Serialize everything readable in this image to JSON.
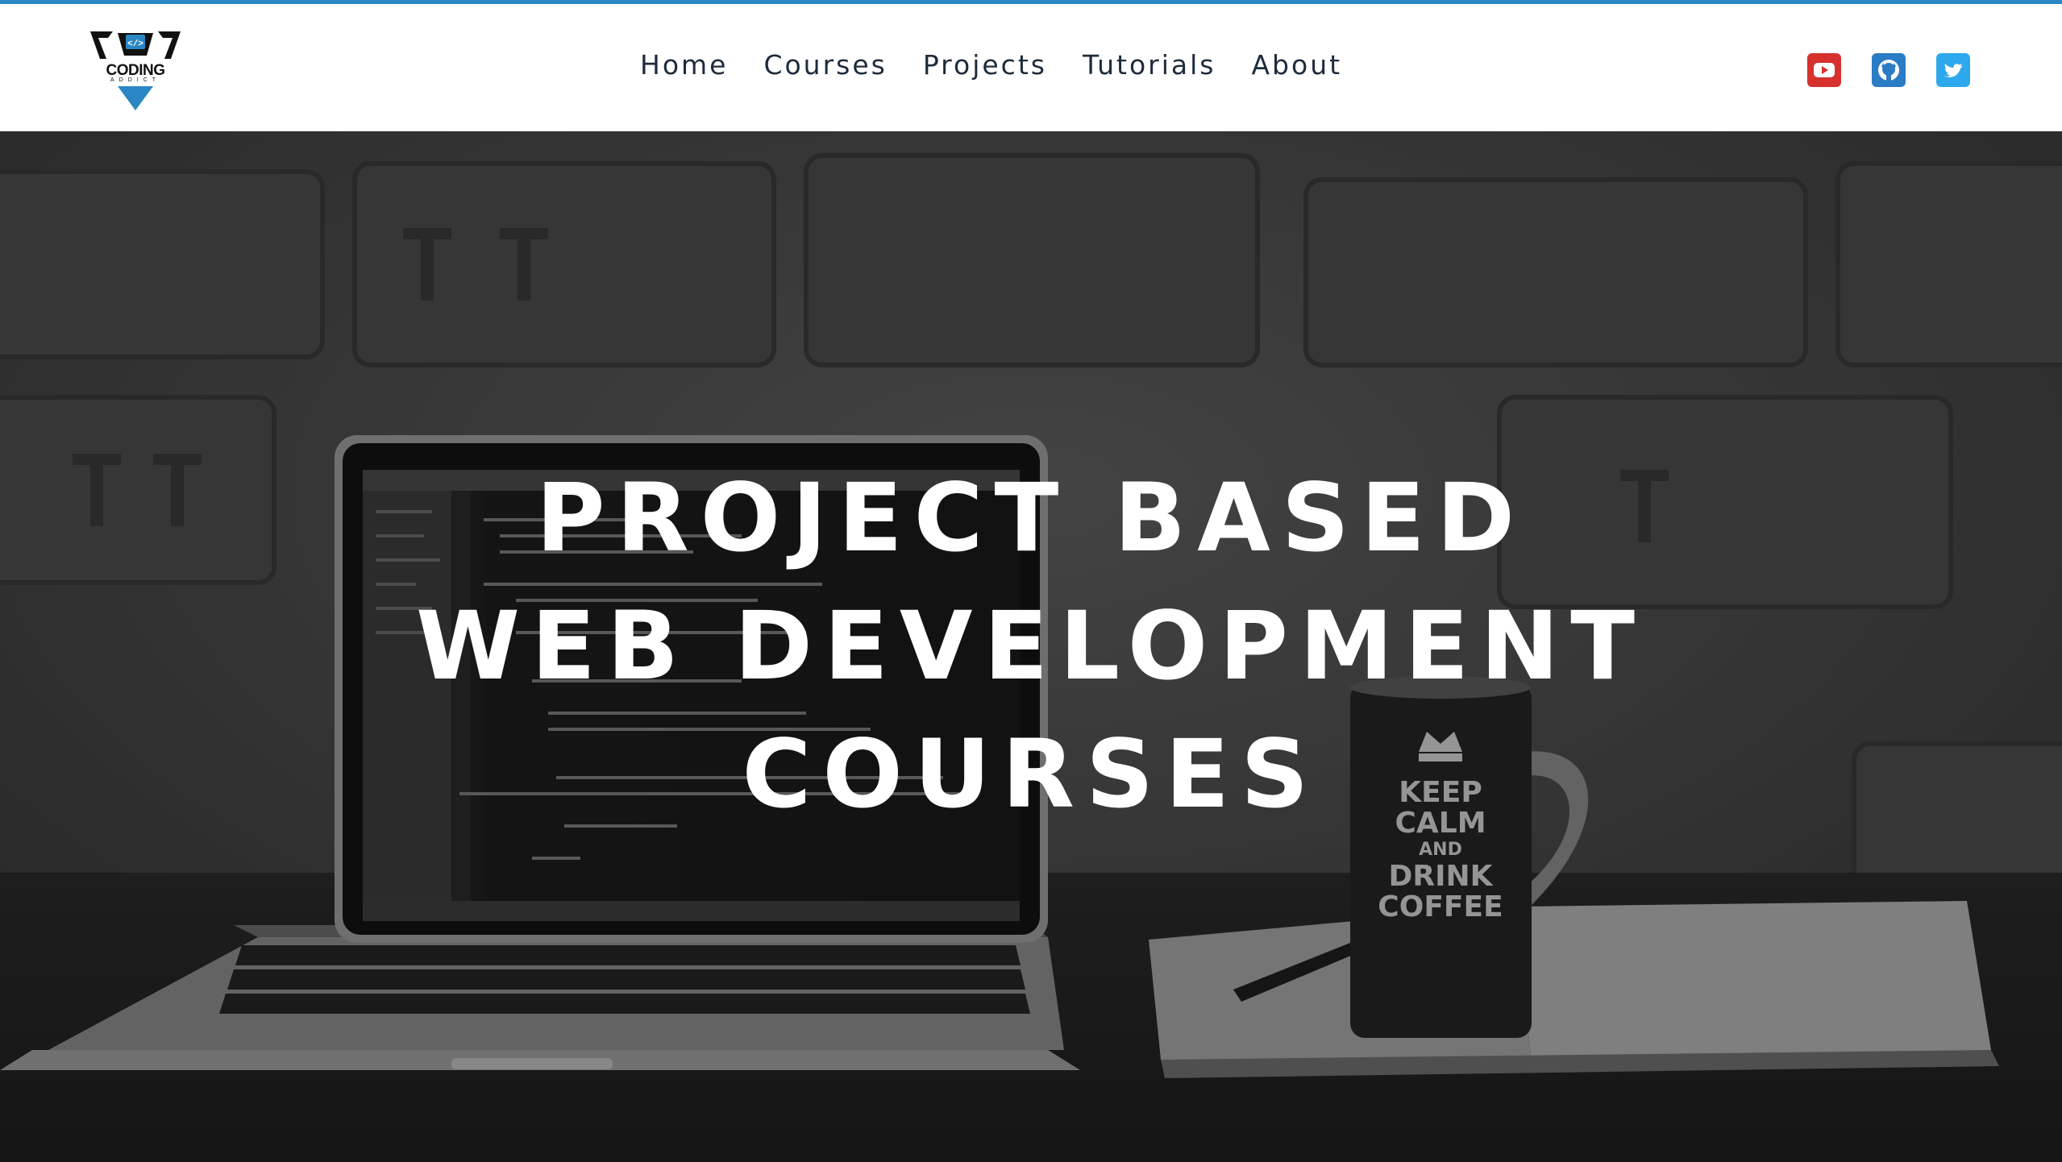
{
  "brand": {
    "logo_line1": "CODING",
    "logo_line2": "ADDICT"
  },
  "nav": {
    "items": [
      {
        "label": "Home"
      },
      {
        "label": "Courses"
      },
      {
        "label": "Projects"
      },
      {
        "label": "Tutorials"
      },
      {
        "label": "About"
      }
    ]
  },
  "social": [
    {
      "icon": "youtube-icon",
      "color": "#d6312c"
    },
    {
      "icon": "github-icon",
      "color": "#2a7cc4"
    },
    {
      "icon": "twitter-icon",
      "color": "#2ea8ed"
    }
  ],
  "hero": {
    "title_lines": [
      "PROJECT BASED",
      "WEB DEVELOPMENT",
      "COURSES"
    ],
    "mug_text": [
      "KEEP",
      "CALM",
      "AND",
      "DRINK",
      "COFFEE"
    ]
  },
  "colors": {
    "accent": "#2b87c4",
    "nav_text": "#1d2b3b"
  }
}
